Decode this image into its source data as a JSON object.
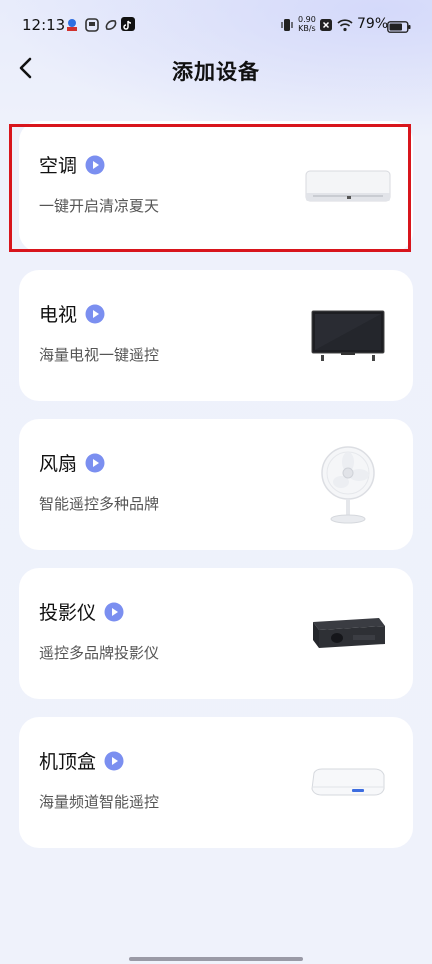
{
  "status_bar": {
    "time": "12:13",
    "net_speed_value": "0.90",
    "net_speed_unit": "KB/s",
    "battery": "79%",
    "icons": [
      "app-icon-1",
      "app-icon-2",
      "app-icon-3",
      "tiktok-icon",
      "vibrate-icon",
      "network-speed",
      "close-box-icon",
      "wifi-icon",
      "battery-icon"
    ]
  },
  "header": {
    "title": "添加设备",
    "back_icon": "chevron-left-icon"
  },
  "devices": [
    {
      "title": "空调",
      "subtitle": "一键开启清凉夏天",
      "image": "air-conditioner"
    },
    {
      "title": "电视",
      "subtitle": "海量电视一键遥控",
      "image": "television"
    },
    {
      "title": "风扇",
      "subtitle": "智能遥控多种品牌",
      "image": "fan"
    },
    {
      "title": "投影仪",
      "subtitle": "遥控多品牌投影仪",
      "image": "projector"
    },
    {
      "title": "机顶盒",
      "subtitle": "海量频道智能遥控",
      "image": "set-top-box"
    }
  ],
  "colors": {
    "accent": "#7b8ff0",
    "highlight": "#d8151c",
    "card": "#ffffff"
  }
}
